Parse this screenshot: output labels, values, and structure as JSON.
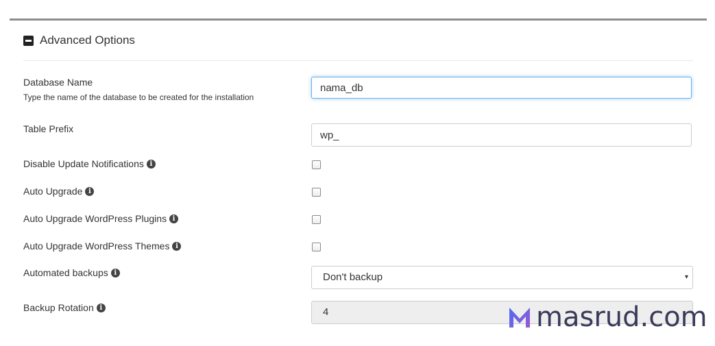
{
  "panel": {
    "title": "Advanced Options"
  },
  "fields": {
    "database_name": {
      "label": "Database Name",
      "description": "Type the name of the database to be created for the installation",
      "value": "nama_db"
    },
    "table_prefix": {
      "label": "Table Prefix",
      "value": "wp_"
    },
    "disable_update_notifications": {
      "label": "Disable Update Notifications",
      "checked": false
    },
    "auto_upgrade": {
      "label": "Auto Upgrade",
      "checked": false
    },
    "auto_upgrade_plugins": {
      "label": "Auto Upgrade WordPress Plugins",
      "checked": false
    },
    "auto_upgrade_themes": {
      "label": "Auto Upgrade WordPress Themes",
      "checked": false
    },
    "automated_backups": {
      "label": "Automated backups",
      "selected": "Don't backup"
    },
    "backup_rotation": {
      "label": "Backup Rotation",
      "selected": "4"
    }
  },
  "icons": {
    "info": "i",
    "caret": "▾"
  },
  "watermark": {
    "text": "masrud.com"
  },
  "colors": {
    "focus_border": "#66afe9",
    "watermark_blue": "#4a6cf7",
    "watermark_purple": "#9b59d0"
  }
}
